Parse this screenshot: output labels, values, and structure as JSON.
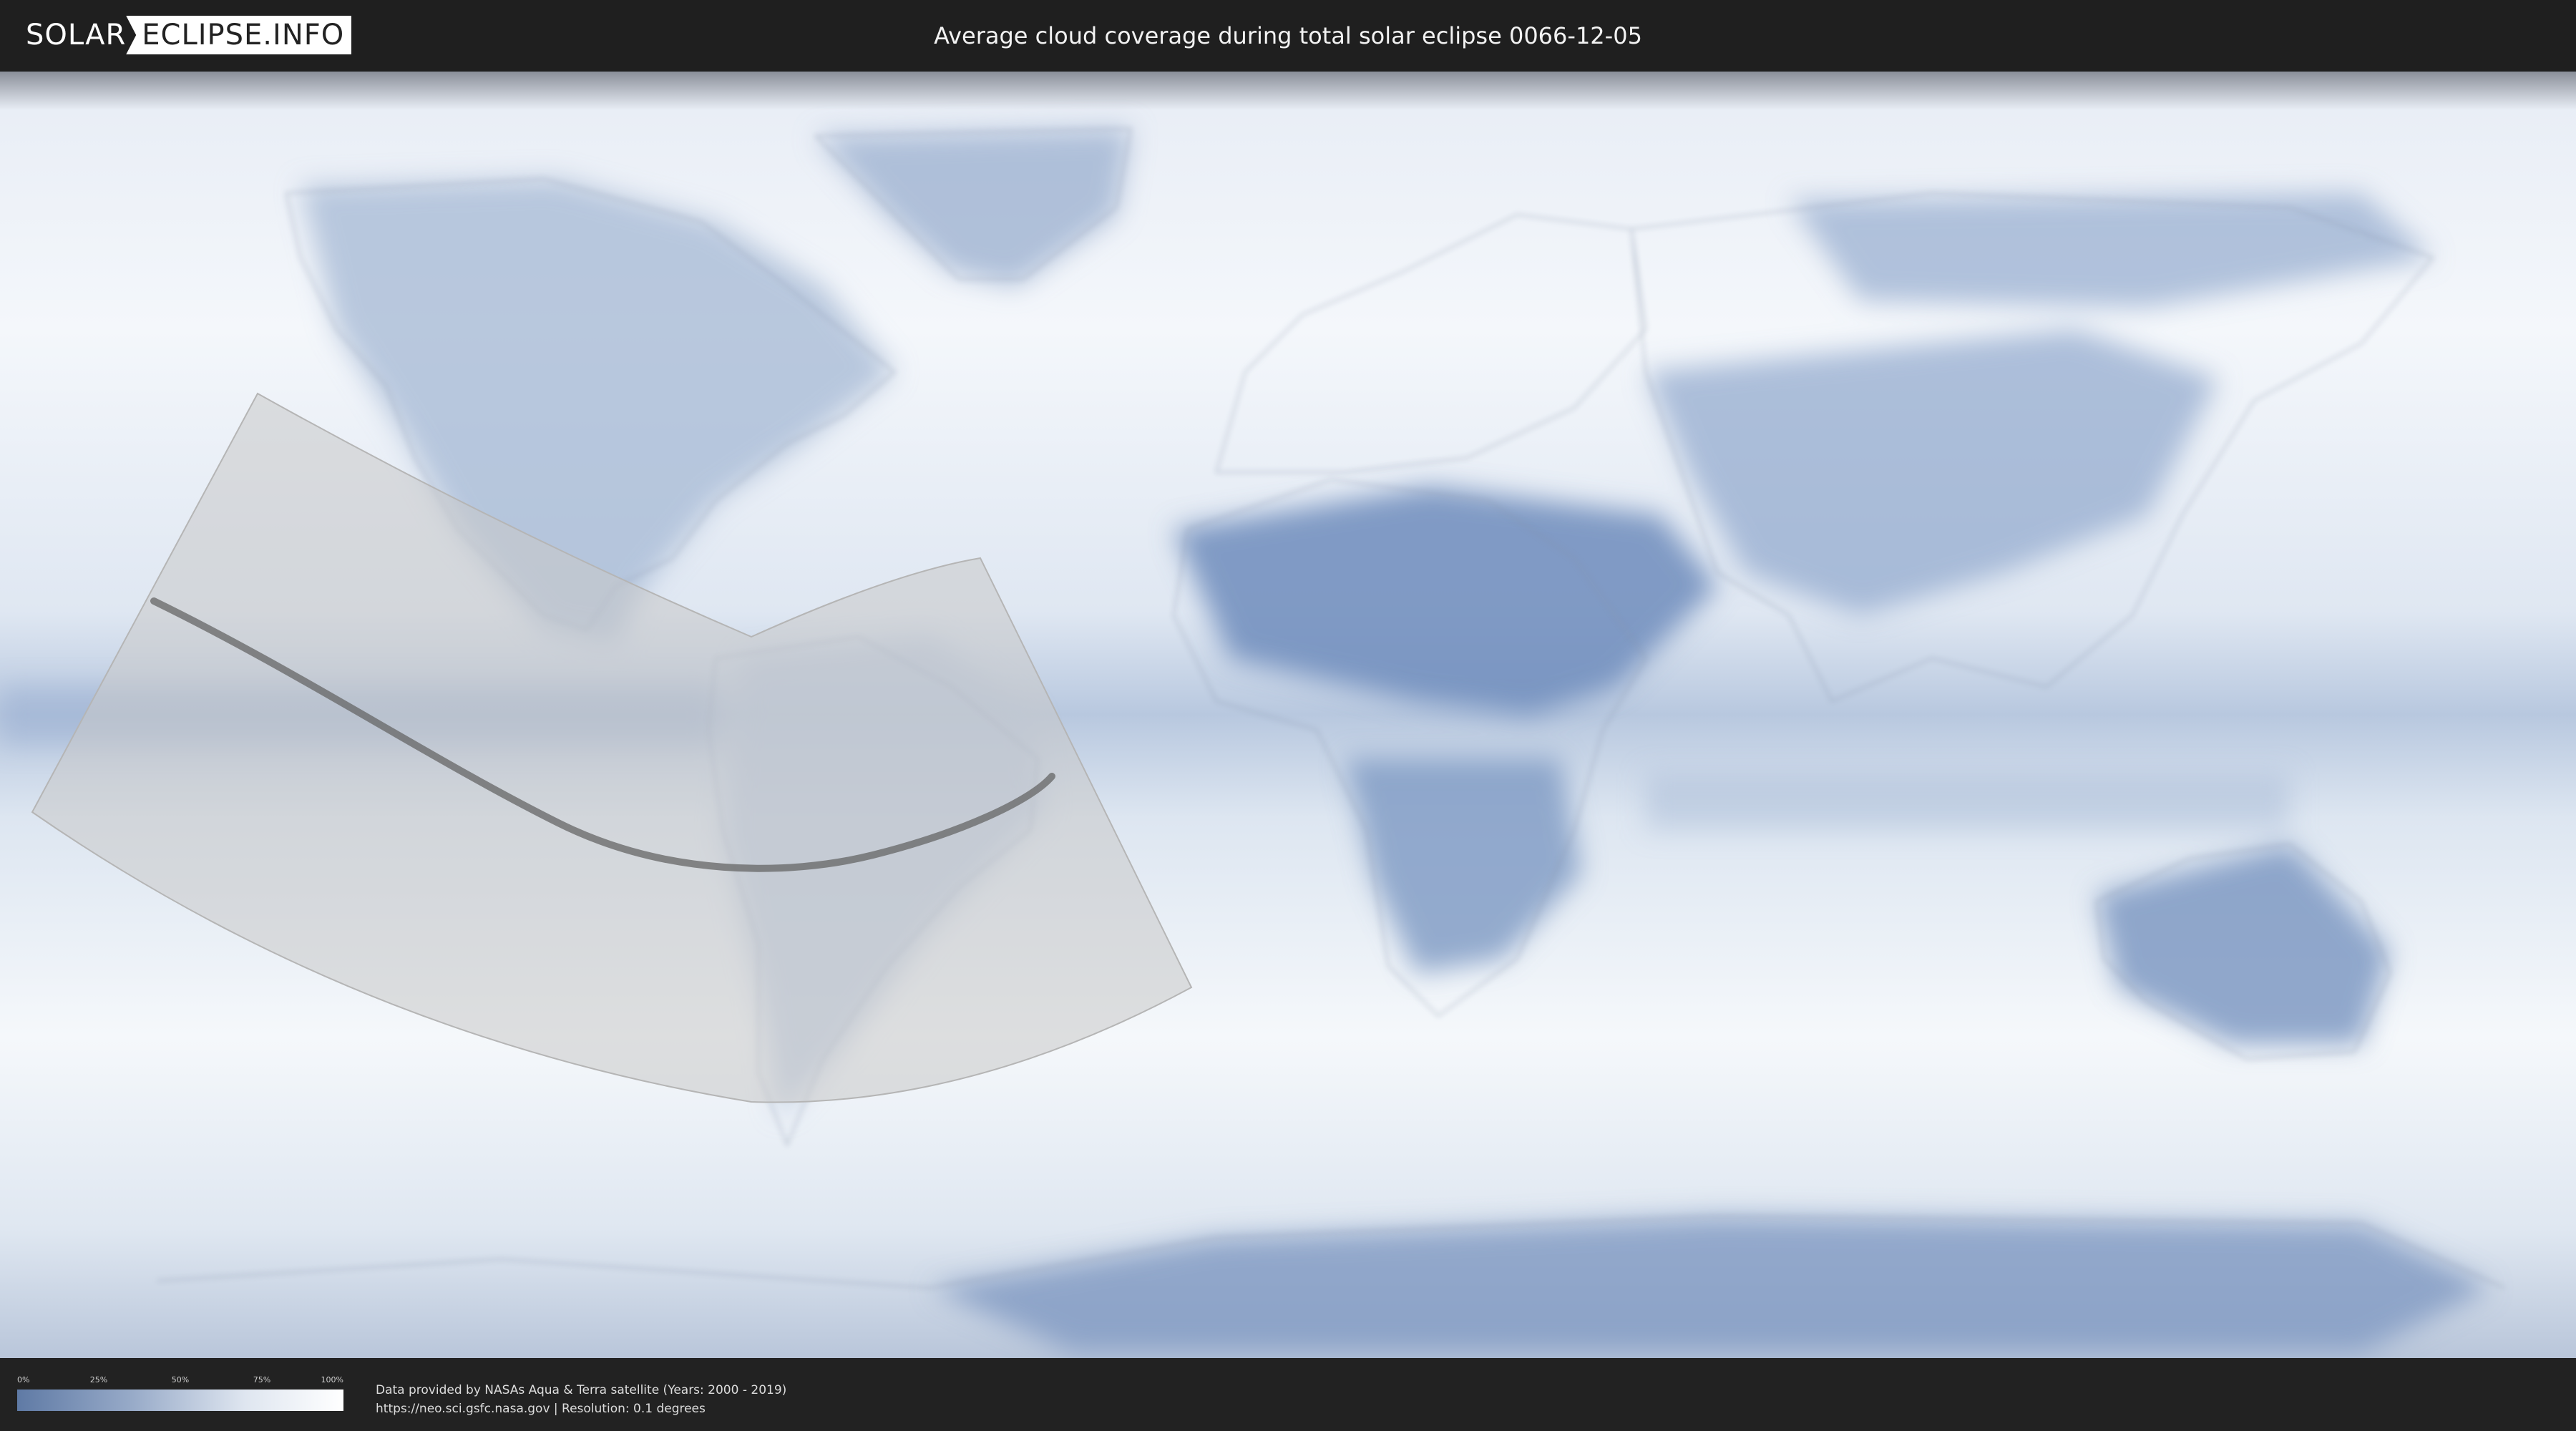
{
  "header": {
    "logo_left": "SOLAR",
    "logo_right": "ECLIPSE.INFO",
    "title": "Average cloud coverage during total solar eclipse 0066-12-05"
  },
  "legend": {
    "ticks": [
      "0%",
      "25%",
      "50%",
      "75%",
      "100%"
    ],
    "colors": {
      "low": "#5f7aa5",
      "high": "#ffffff"
    }
  },
  "credits": {
    "line1": "Data provided by NASAs Aqua & Terra satellite (Years: 2000 - 2019)",
    "line2": "https://neo.sci.gsfc.nasa.gov | Resolution: 0.1 degrees"
  },
  "map": {
    "icon": "world-cloud-map",
    "colors": {
      "clear": "#5d7eb0",
      "cloudy": "#f3f6fa",
      "eclipse_zone": "#c8c8c8",
      "central_line": "#666666"
    }
  }
}
